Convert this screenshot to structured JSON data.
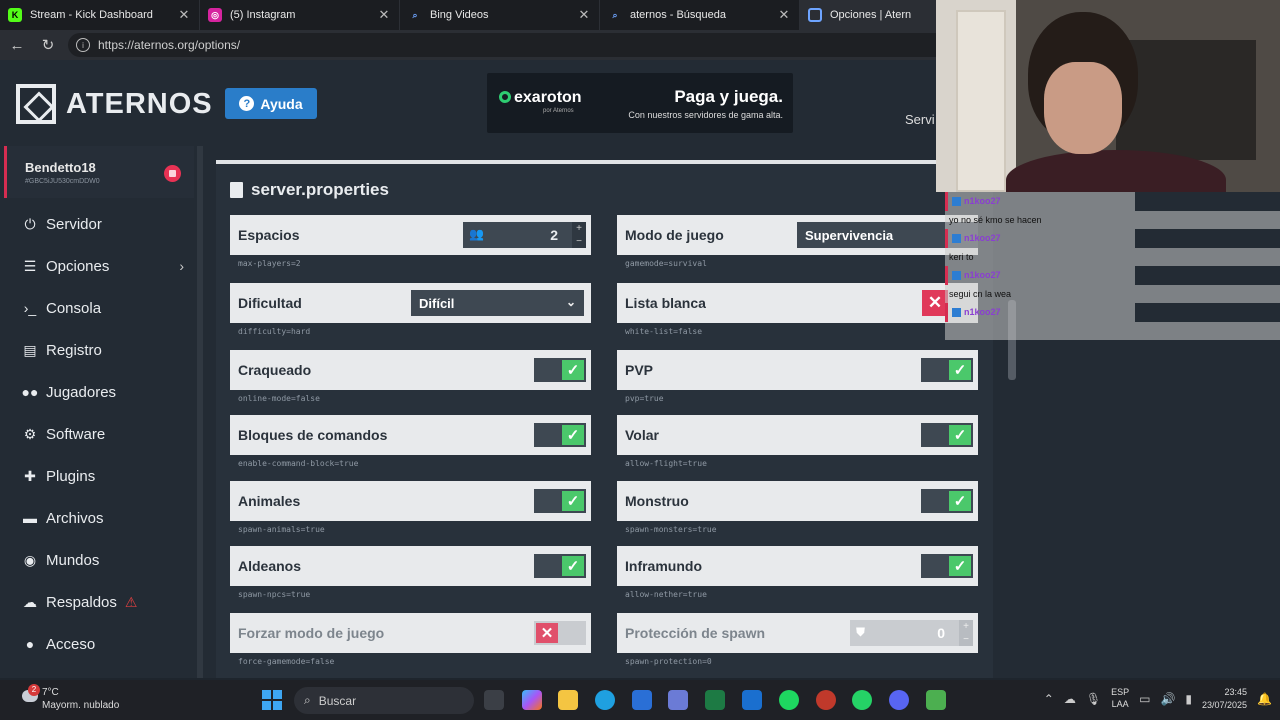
{
  "browser": {
    "tabs": [
      {
        "title": "Stream - Kick Dashboard",
        "color": "#53fc18",
        "glyph": "K"
      },
      {
        "title": "(5) Instagram",
        "color": "#d6249f",
        "glyph": "◎"
      },
      {
        "title": "Bing Videos",
        "color": "#3a6fd8",
        "glyph": "⌕"
      },
      {
        "title": "aternos - Búsqueda",
        "color": "#3a6fd8",
        "glyph": "⌕"
      },
      {
        "title": "Opciones | Atern",
        "color": "#2a7dc9",
        "glyph": "▣"
      }
    ],
    "url": "https://aternos.org/options/"
  },
  "header": {
    "logo": "ATERNOS",
    "help": "Ayuda",
    "ad_brand": "exaroton",
    "ad_brand_sub": "por Aternos",
    "ad_headline": "Paga y juega.",
    "ad_sub": "Con nuestros servidores de gama alta.",
    "right_label": "Servi"
  },
  "sidebar": {
    "user": "Bendetto18",
    "user_id": "#GBC5iJU530cmDDW0",
    "items": [
      {
        "label": "Servidor",
        "icon": "power-icon",
        "glyph": "⏻"
      },
      {
        "label": "Opciones",
        "icon": "sliders-icon",
        "glyph": "☰"
      },
      {
        "label": "Consola",
        "icon": "terminal-icon",
        "glyph": "›_"
      },
      {
        "label": "Registro",
        "icon": "file-icon",
        "glyph": "▤"
      },
      {
        "label": "Jugadores",
        "icon": "users-icon",
        "glyph": "●●"
      },
      {
        "label": "Software",
        "icon": "gear-icon",
        "glyph": "⚙"
      },
      {
        "label": "Plugins",
        "icon": "puzzle-icon",
        "glyph": "✚"
      },
      {
        "label": "Archivos",
        "icon": "folder-icon",
        "glyph": "▬"
      },
      {
        "label": "Mundos",
        "icon": "globe-icon",
        "glyph": "◉"
      },
      {
        "label": "Respaldos",
        "icon": "cloud-icon",
        "glyph": "☁"
      },
      {
        "label": "Acceso",
        "icon": "user-lock-icon",
        "glyph": "●"
      }
    ]
  },
  "main": {
    "title": "server.properties",
    "properties": {
      "espacios": {
        "label": "Espacios",
        "key": "max-players=2",
        "value": "2"
      },
      "modo": {
        "label": "Modo de juego",
        "key": "gamemode=survival",
        "value": "Supervivencia"
      },
      "dificultad": {
        "label": "Dificultad",
        "key": "difficulty=hard",
        "value": "Difícil"
      },
      "lista": {
        "label": "Lista blanca",
        "key": "white-list=false"
      },
      "craqueado": {
        "label": "Craqueado",
        "key": "online-mode=false"
      },
      "pvp": {
        "label": "PVP",
        "key": "pvp=true"
      },
      "bloques": {
        "label": "Bloques de comandos",
        "key": "enable-command-block=true"
      },
      "volar": {
        "label": "Volar",
        "key": "allow-flight=true"
      },
      "animales": {
        "label": "Animales",
        "key": "spawn-animals=true"
      },
      "monstruo": {
        "label": "Monstruo",
        "key": "spawn-monsters=true"
      },
      "aldeanos": {
        "label": "Aldeanos",
        "key": "spawn-npcs=true"
      },
      "inframundo": {
        "label": "Inframundo",
        "key": "allow-nether=true"
      },
      "forzar": {
        "label": "Forzar modo de juego",
        "key": "force-gamemode=false"
      },
      "proteccion": {
        "label": "Protección de spawn",
        "key": "spawn-protection=0",
        "value": "0"
      }
    }
  },
  "chat": [
    {
      "user": "n1koo27",
      "msg": "yo no sé kmo se hacen"
    },
    {
      "user": "n1koo27",
      "msg": "keri to"
    },
    {
      "user": "n1koo27",
      "msg": "segui cn la wea"
    },
    {
      "user": "n1koo27",
      "msg": ""
    }
  ],
  "taskbar": {
    "temp": "7°C",
    "weather": "Mayorm. nublado",
    "notif": "2",
    "search": "Buscar",
    "lang1": "ESP",
    "lang2": "LAA",
    "time": "23:45",
    "date": "23/07/2025"
  }
}
